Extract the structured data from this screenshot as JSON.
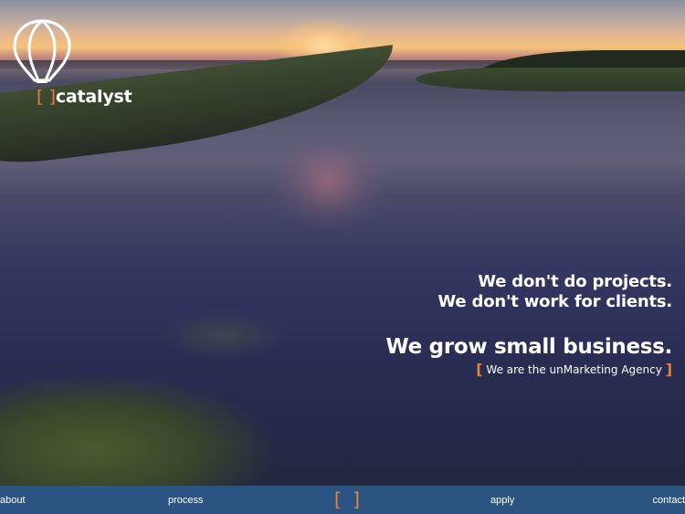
{
  "brand": {
    "bracket_left": "[",
    "bracket_right": "]",
    "name": "catalyst",
    "logo_icon": "hot-air-balloon-icon",
    "accent_color": "#e8823a"
  },
  "hero": {
    "line1": "We don't do projects.",
    "line2": "We don't work for clients.",
    "headline": "We grow small business.",
    "subline_bracket_left": "[",
    "subline": "We are the unMarketing Agency",
    "subline_bracket_right": "]"
  },
  "nav": {
    "background_color": "#2c5483",
    "about": "about",
    "process": "process",
    "center_logo": "[ ]",
    "apply": "apply",
    "contact": "contact"
  }
}
